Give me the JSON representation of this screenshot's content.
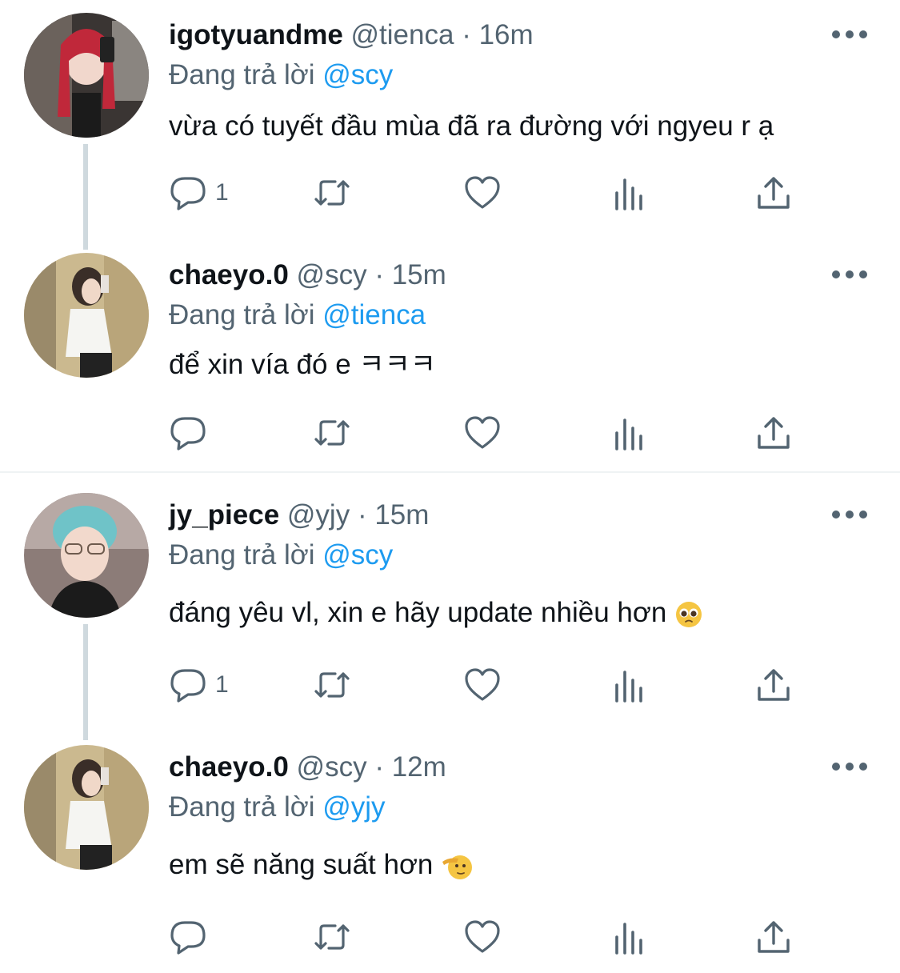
{
  "reply_prefix": "Đang trả lời",
  "separator": "·",
  "tweets": [
    {
      "name": "igotyuandme",
      "handle": "@tienca",
      "time": "16m",
      "reply_to": "@scy",
      "text": "vừa có tuyết đầu mùa đã ra đường với ngyeu r ạ",
      "reply_count": "1",
      "avatar": "avatar-red-hair-selfie"
    },
    {
      "name": "chaeyo.0",
      "handle": "@scy",
      "time": "15m",
      "reply_to": "@tienca",
      "text": "để xin vía đó e ㅋㅋㅋ",
      "reply_count": "",
      "avatar": "avatar-mirror-selfie"
    },
    {
      "name": "jy_piece",
      "handle": "@yjy",
      "time": "15m",
      "reply_to": "@scy",
      "text": "đáng yêu vl, xin e hãy update nhiều hơn",
      "text_emoji": "pleading-face-emoji",
      "reply_count": "1",
      "avatar": "avatar-teal-hair"
    },
    {
      "name": "chaeyo.0",
      "handle": "@scy",
      "time": "12m",
      "reply_to": "@yjy",
      "text": "em sẽ năng suất hơn",
      "text_emoji": "saluting-face-emoji",
      "reply_count": "",
      "avatar": "avatar-mirror-selfie"
    }
  ],
  "icons": [
    "reply-icon",
    "retweet-icon",
    "like-icon",
    "views-icon",
    "share-icon",
    "more-icon"
  ],
  "colors": {
    "link": "#1d9bf0",
    "secondary": "#536471",
    "thread_line": "#cfd9de"
  }
}
